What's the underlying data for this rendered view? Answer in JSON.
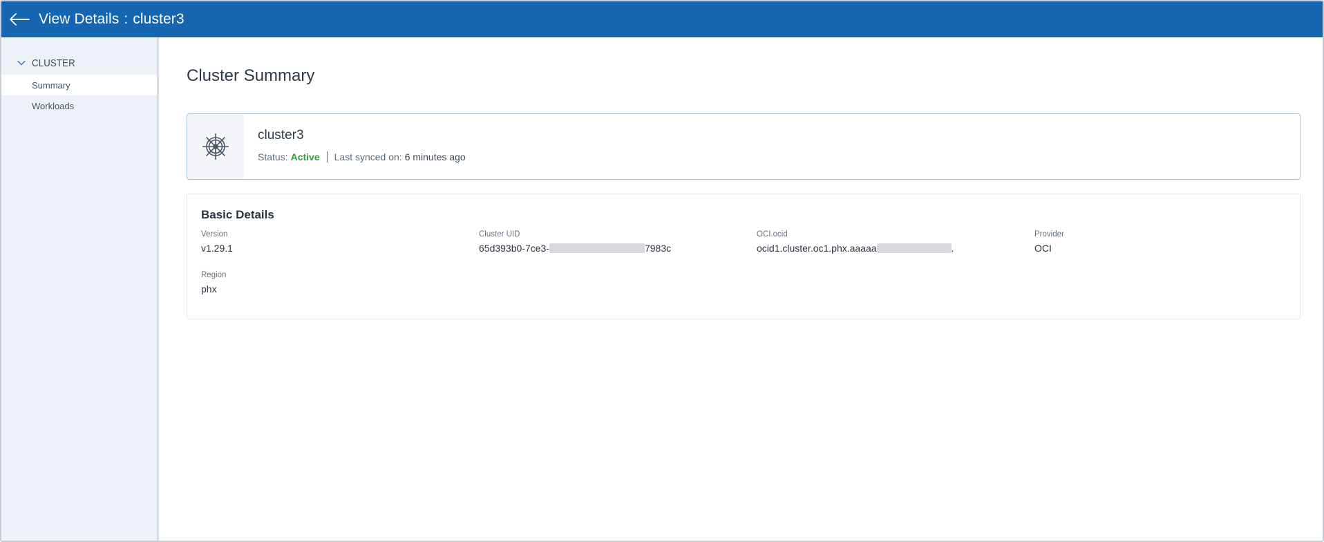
{
  "header": {
    "title_prefix": "View Details",
    "separator": ":",
    "cluster_name": "cluster3",
    "colors": {
      "bar": "#1565b0",
      "text": "#ffffff"
    },
    "back_icon": "arrow-left-icon"
  },
  "sidebar": {
    "group": {
      "label": "CLUSTER",
      "icon": "chevron-down-icon",
      "expanded": true
    },
    "items": [
      {
        "label": "Summary",
        "active": true
      },
      {
        "label": "Workloads",
        "active": false
      }
    ]
  },
  "main": {
    "page_title": "Cluster Summary",
    "summary": {
      "icon": "helm-wheel-icon",
      "name": "cluster3",
      "status_label": "Status:",
      "status_value": "Active",
      "status_color": "#2e9e3a",
      "synced_label": "Last synced on:",
      "synced_value": "6 minutes ago"
    },
    "basic_details": {
      "title": "Basic Details",
      "fields": [
        {
          "label": "Version",
          "value": "v1.29.1"
        },
        {
          "label": "Cluster UID",
          "value_start": "65d393b0-7ce3-",
          "value_end": "7983c",
          "redacted": true
        },
        {
          "label": "OCI.ocid",
          "value_start": "ocid1.cluster.oc1.phx.aaaaa",
          "value_end": ".",
          "redacted": true
        },
        {
          "label": "Provider",
          "value": "OCI"
        },
        {
          "label": "Region",
          "value": "phx"
        }
      ]
    }
  }
}
